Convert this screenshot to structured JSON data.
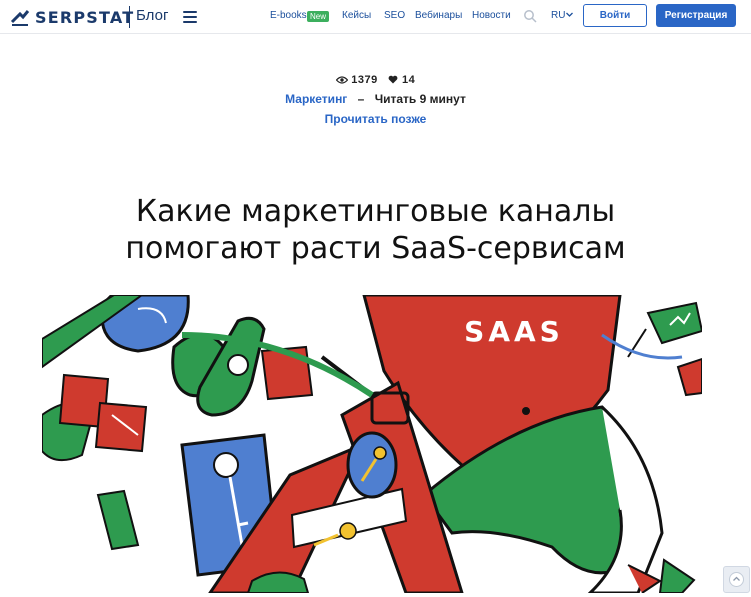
{
  "header": {
    "logo_text": "SERPSTAT",
    "blog_label": "Блог",
    "nav": [
      {
        "label": "E-books"
      },
      {
        "label": "Кейсы"
      },
      {
        "label": "SEO"
      },
      {
        "label": "Вебинары"
      },
      {
        "label": "Новости"
      }
    ],
    "new_badge": "New",
    "language": "RU",
    "login_label": "Войти",
    "register_label": "Регистрация"
  },
  "article": {
    "views": "1379",
    "likes": "14",
    "category": "Маркетинг",
    "separator": "–",
    "read_time": "Читать 9 минут",
    "read_later": "Прочитать позже",
    "title_line1": "Какие маркетинговые каналы",
    "title_line2": "помогают расти SaaS-сервисам",
    "hero_text": "SAAS"
  },
  "colors": {
    "brand_navy": "#1b3a6b",
    "link_blue": "#2a66c6",
    "badge_green": "#3caf5e",
    "illustration_red": "#cf3a2e",
    "illustration_green": "#2e9b4f",
    "illustration_blue": "#4f7fd0",
    "key_yellow": "#f2c230"
  },
  "icons": {
    "logo": "serpstat-logo-icon",
    "menu": "hamburger-menu-icon",
    "search": "search-icon",
    "views": "eye-icon",
    "likes": "heart-icon",
    "language_dropdown": "chevron-down-icon",
    "scroll": "scroll-icon"
  }
}
